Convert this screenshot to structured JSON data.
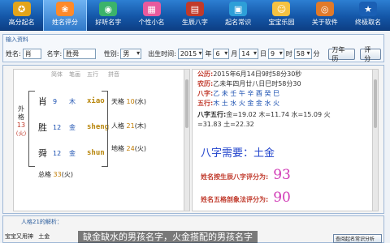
{
  "toolbar": {
    "items": [
      {
        "label": "高分起名",
        "icon": "certificate-icon",
        "color": "#e2a41a"
      },
      {
        "label": "姓名评分",
        "icon": "ribbon-icon",
        "color": "#ff8a2a"
      },
      {
        "label": "好听名字",
        "icon": "palette-icon",
        "color": "#3bb36b"
      },
      {
        "label": "个性小名",
        "icon": "card-icon",
        "color": "#e85a9d"
      },
      {
        "label": "生辰八字",
        "icon": "calendar-icon",
        "color": "#c03a2b"
      },
      {
        "label": "起名常识",
        "icon": "book-icon",
        "color": "#2d9fd8"
      },
      {
        "label": "宝宝乐园",
        "icon": "baby-icon",
        "color": "#f4c242"
      },
      {
        "label": "关于软件",
        "icon": "disc-icon",
        "color": "#e07a2a"
      },
      {
        "label": "终极取名",
        "icon": "star-icon",
        "color": "#ffffff"
      }
    ]
  },
  "input": {
    "title": "输入资料",
    "surname_label": "姓名:",
    "surname_value": "肖",
    "given_label": "名字:",
    "given_value": "胜舜",
    "gender_label": "性别:",
    "gender_value": "男",
    "birth_label": "出生时间:",
    "year": "2015",
    "year_unit": "年",
    "month": "6",
    "month_unit": "月",
    "day": "14",
    "day_unit": "日",
    "hour": "9",
    "hour_unit": "时",
    "minute": "58",
    "minute_unit": "分",
    "calendar_button": "万年历",
    "score_button": "评分"
  },
  "wuge": {
    "headers": {
      "simplified": "简体",
      "strokes": "笔画",
      "wuxing": "五行",
      "pinyin": "拼音"
    },
    "outer_label": "外格",
    "outer_value": "13",
    "outer_element": "(火)",
    "chars": [
      {
        "ch": "肖",
        "strokes": "9",
        "wuxing": "木",
        "pinyin": "xiao"
      },
      {
        "ch": "胜",
        "strokes": "12",
        "wuxing": "金",
        "pinyin": "sheng"
      },
      {
        "ch": "舜",
        "strokes": "12",
        "wuxing": "金",
        "pinyin": "shun"
      }
    ],
    "tian": {
      "label": "天格",
      "value": "10",
      "element": "(水)"
    },
    "ren": {
      "label": "人格",
      "value": "21",
      "element": "(木)"
    },
    "di": {
      "label": "地格",
      "value": "24",
      "element": "(火)"
    },
    "total": {
      "label": "总格",
      "value": "33",
      "element": "(火)"
    }
  },
  "bazi": {
    "gongli_label": "公历:",
    "gongli_value": "2015年6月14日9时58分30秒",
    "nongli_label": "农历:",
    "nongli_value": "乙未年四月廿八日巳时58分30",
    "bazi_label": "八字:",
    "bazi_value": "乙 未 壬 午 辛 酉 癸 巳",
    "wuxing_label": "五行:",
    "wuxing_value": "木 土 水 火 金 金 水 火",
    "score_label": "八字五行:",
    "score_value": "金=19.02 木=11.74 水=15.09 火",
    "score_value2": "=31.83 土=22.32",
    "need": "八字需要：土金",
    "bazi_score_label": "姓名按生辰八字评分为:",
    "bazi_score": "93",
    "wuge_score_label": "姓名五格剖象法评分为:",
    "wuge_score": "90"
  },
  "bottom": {
    "title": "人格21的解析：",
    "small_label": "宝宝又用神",
    "small_value": "土金",
    "button": "查阅起名常识分析"
  },
  "banner": "缺金缺水的男孩名字，火金搭配的男孩名字"
}
